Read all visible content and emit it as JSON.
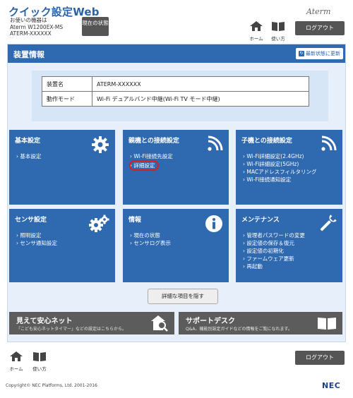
{
  "header": {
    "title": "クイック設定Web",
    "device_line1": "お使いの機器は",
    "device_line2": "Aterm W1200EX-MS",
    "device_line3": "ATERM-XXXXXX",
    "status_button": "現在の状態",
    "brand": "Aterm",
    "home_label": "ホーム",
    "help_label": "使い方",
    "logout": "ログアウト"
  },
  "panel": {
    "title": "装置情報",
    "refresh": "最新状態に更新",
    "info": [
      {
        "key": "装置名",
        "value": "ATERM-XXXXXX"
      },
      {
        "key": "動作モード",
        "value": "Wi-Fi デュアルバンド中継(Wi-Fi TV モード中継)"
      }
    ]
  },
  "tiles": {
    "basic": {
      "title": "基本設定",
      "icon": "gear-icon",
      "links": [
        "基本設定"
      ]
    },
    "parent": {
      "title": "親機との接続設定",
      "icon": "wifi-icon",
      "links": [
        "Wi-Fi接続先設定",
        "詳細設定"
      ],
      "highlighted": "詳細設定"
    },
    "child": {
      "title": "子機との接続設定",
      "icon": "wifi-icon",
      "links": [
        "Wi-Fi詳細設定(2.4GHz)",
        "Wi-Fi詳細設定(5GHz)",
        "MACアドレスフィルタリング",
        "Wi-Fi接続通知設定"
      ]
    },
    "sensor": {
      "title": "センサ設定",
      "icon": "gears-icon",
      "links": [
        "照明設定",
        "センサ通知設定"
      ]
    },
    "info": {
      "title": "情報",
      "icon": "info-icon",
      "links": [
        "現在の状態",
        "センサログ表示"
      ]
    },
    "maint": {
      "title": "メンテナンス",
      "icon": "wrench-icon",
      "links": [
        "管理者パスワードの変更",
        "設定値の保存＆復元",
        "設定値の初期化",
        "ファームウェア更新",
        "再起動"
      ]
    }
  },
  "detail_toggle": "詳細な項目を隠す",
  "promos": {
    "anshin": {
      "title": "見えて安心ネット",
      "desc": "「こども安心ネットタイマー」などの設定はこちらから。"
    },
    "support": {
      "title": "サポートデスク",
      "desc": "Q&A、機能別設定ガイドなどの情報をご覧になれます。"
    }
  },
  "footer": {
    "home_label": "ホーム",
    "help_label": "使い方",
    "logout": "ログアウト",
    "copyright": "Copyright© NEC Platforms, Ltd. 2001-2016",
    "logo": "NEC"
  },
  "colors": {
    "primary": "#2f69b0",
    "dark_button": "#555555",
    "highlight": "#d62020"
  }
}
